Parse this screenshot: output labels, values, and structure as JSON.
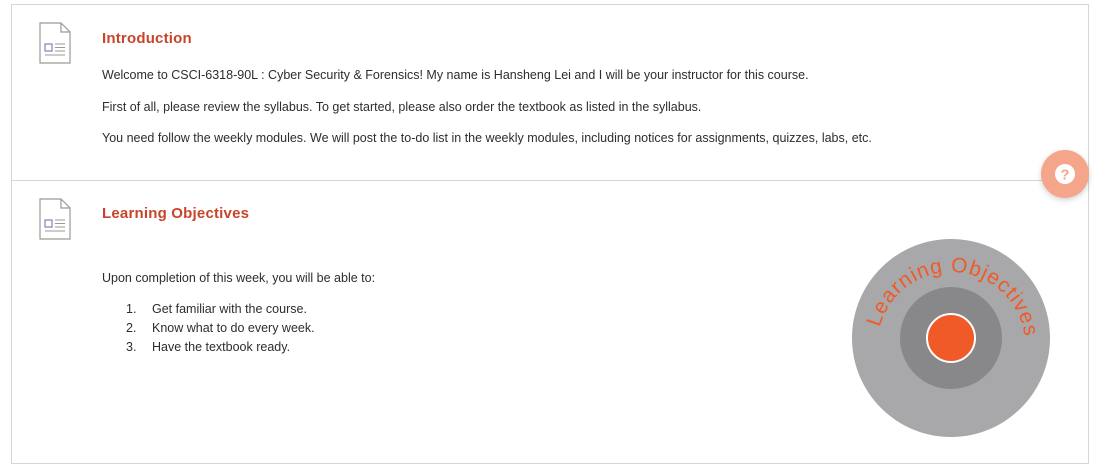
{
  "colors": {
    "accent": "#c8442a",
    "bullseye": "#f05a28",
    "help": "#f4a58a"
  },
  "intro": {
    "title": "Introduction",
    "icon": "document-icon",
    "paragraphs": [
      "Welcome to CSCI-6318-90L : Cyber Security & Forensics! My name is Hansheng Lei and I will be your instructor for this course.",
      "First of all, please review the syllabus. To get started, please also order the textbook as listed in the syllabus.",
      "You need follow the weekly modules. We will post the to-do list in the weekly modules, including notices for assignments, quizzes, labs, etc."
    ]
  },
  "objectives": {
    "title": "Learning Objectives",
    "icon": "document-icon",
    "intro": "Upon completion of this week, you will be able to:",
    "items": [
      {
        "num": "1.",
        "text": "Get familiar with the course."
      },
      {
        "num": "2.",
        "text": "Know what to do every week."
      },
      {
        "num": "3.",
        "text": "Have the textbook ready."
      }
    ],
    "graphic_label": "Learning Objectives"
  },
  "help_button": {
    "icon": "question-icon",
    "glyph": "?"
  }
}
